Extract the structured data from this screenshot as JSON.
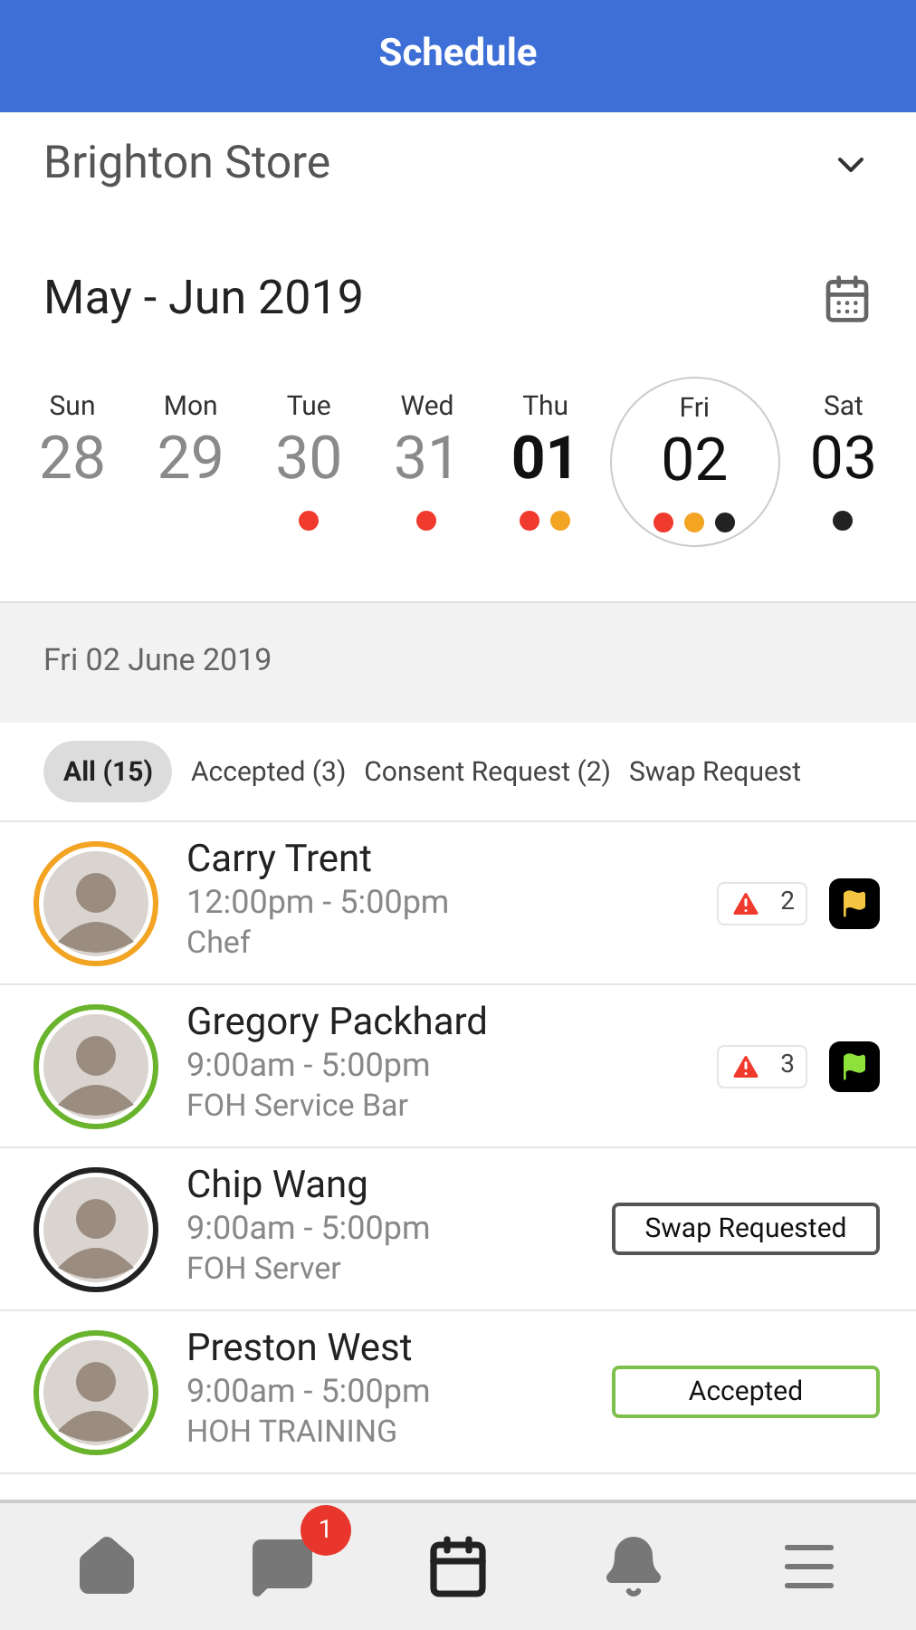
{
  "header": {
    "title": "Schedule"
  },
  "store": {
    "name": "Brighton Store"
  },
  "month": {
    "label": "May - Jun 2019"
  },
  "days": [
    {
      "weekday": "Sun",
      "date": "28",
      "kind": "past",
      "selected": false
    },
    {
      "weekday": "Mon",
      "date": "29",
      "kind": "past",
      "selected": false
    },
    {
      "weekday": "Tue",
      "date": "30",
      "kind": "past",
      "selected": false,
      "dots": [
        {
          "color": "#f03a2e"
        }
      ]
    },
    {
      "weekday": "Wed",
      "date": "31",
      "kind": "past",
      "selected": false,
      "dots": [
        {
          "color": "#f03a2e"
        }
      ]
    },
    {
      "weekday": "Thu",
      "date": "01",
      "kind": "today",
      "selected": false,
      "dots": [
        {
          "color": "#f03a2e"
        },
        {
          "color": "#f2a422"
        }
      ]
    },
    {
      "weekday": "Fri",
      "date": "02",
      "kind": "future",
      "selected": true,
      "dots": [
        {
          "color": "#f03a2e"
        },
        {
          "color": "#f2a422"
        },
        {
          "color": "#222222"
        }
      ]
    },
    {
      "weekday": "Sat",
      "date": "03",
      "kind": "future",
      "selected": false,
      "dots": [
        {
          "color": "#222222"
        }
      ]
    }
  ],
  "date_header": "Fri 02 June 2019",
  "filters": [
    {
      "label": "All (15)",
      "selected": true
    },
    {
      "label": "Accepted (3)",
      "selected": false
    },
    {
      "label": "Consent Request (2)",
      "selected": false
    },
    {
      "label": "Swap Request",
      "selected": false
    }
  ],
  "shifts": [
    {
      "name": "Carry Trent",
      "time": "12:00pm - 5:00pm",
      "role": "Chef",
      "color": "#f2a422",
      "kind": "alerts",
      "alerts": "2",
      "flag": {
        "color": "#f5c542"
      }
    },
    {
      "name": "Gregory Packhard",
      "time": "9:00am - 5:00pm",
      "role": "FOH Service Bar",
      "color": "#6ab42d",
      "kind": "alerts",
      "alerts": "3",
      "flag": {
        "color": "#8ee03a"
      }
    },
    {
      "name": "Chip Wang",
      "time": "9:00am - 5:00pm",
      "role": "FOH Server",
      "color": "#222222",
      "kind": "status",
      "status": {
        "label": "Swap Requested",
        "color": "#555555"
      }
    },
    {
      "name": "Preston West",
      "time": "9:00am - 5:00pm",
      "role": "HOH TRAINING",
      "color": "#6ab42d",
      "kind": "status",
      "status": {
        "label": "Accepted",
        "color": "#7cbf4a"
      }
    }
  ],
  "nav": [
    {
      "kind": "home",
      "selected": false
    },
    {
      "kind": "chat",
      "selected": false,
      "badge": "1"
    },
    {
      "kind": "calendar",
      "selected": true
    },
    {
      "kind": "bell",
      "selected": false
    },
    {
      "kind": "menu",
      "selected": false
    }
  ]
}
